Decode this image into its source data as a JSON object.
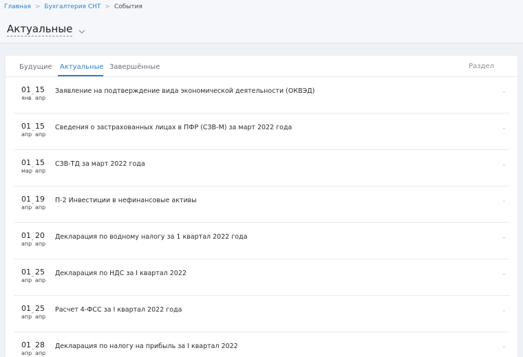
{
  "breadcrumb": {
    "items": [
      {
        "label": "Главная"
      },
      {
        "label": "Бухгалтерия СНТ"
      },
      {
        "label": "События"
      }
    ],
    "separator": ">"
  },
  "page": {
    "title": "Актуальные",
    "title_icon": "chevron-down-icon"
  },
  "tabs": [
    {
      "label": "Будущие",
      "active": false
    },
    {
      "label": "Актуальные",
      "active": true
    },
    {
      "label": "Завершённые",
      "active": false
    }
  ],
  "columns": {
    "section": "Раздел"
  },
  "events": [
    {
      "day_from": "01",
      "mon_from": "янв",
      "day_to": "15",
      "mon_to": "апр",
      "title": "Заявление на подтверждение вида экономической деятельности (ОКВЭД)",
      "section": "-"
    },
    {
      "day_from": "01",
      "mon_from": "апр",
      "day_to": "15",
      "mon_to": "апр",
      "title": "Сведения о застрахованных лицах в ПФР (СЗВ-М) за март 2022 года",
      "section": "-"
    },
    {
      "day_from": "01",
      "mon_from": "мар",
      "day_to": "15",
      "mon_to": "апр",
      "title": "СЗВ-ТД за март 2022 года",
      "section": "-"
    },
    {
      "day_from": "01",
      "mon_from": "апр",
      "day_to": "19",
      "mon_to": "апр",
      "title": "П-2 Инвестиции в нефинансовые активы",
      "section": "-"
    },
    {
      "day_from": "01",
      "mon_from": "апр",
      "day_to": "20",
      "mon_to": "апр",
      "title": "Декларация по водному налогу за 1 квартал 2022 года",
      "section": "-"
    },
    {
      "day_from": "01",
      "mon_from": "апр",
      "day_to": "25",
      "mon_to": "апр",
      "title": "Декларация по НДС за I квартал 2022",
      "section": "-"
    },
    {
      "day_from": "01",
      "mon_from": "апр",
      "day_to": "25",
      "mon_to": "апр",
      "title": "Расчет 4-ФСС  за I квартал 2022 года",
      "section": "-"
    },
    {
      "day_from": "01",
      "mon_from": "апр",
      "day_to": "28",
      "mon_to": "апр",
      "title": "Декларация по налогу на прибыль за I квартал 2022",
      "section": "-"
    }
  ],
  "colors": {
    "accent": "#2f7fc9",
    "background": "#eef1f5",
    "card": "#ffffff"
  }
}
